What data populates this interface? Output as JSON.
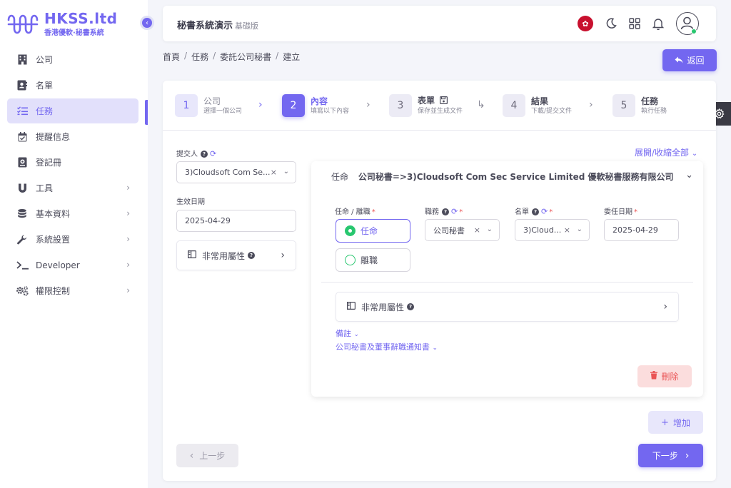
{
  "brand": {
    "title": "HKSS.ltd",
    "subtitle": "香港優軟·秘書系統",
    "accent": "#7367f0"
  },
  "sidebar": {
    "items": [
      {
        "label": "公司",
        "icon": "building-icon"
      },
      {
        "label": "名單",
        "icon": "contact-card-icon"
      },
      {
        "label": "任務",
        "icon": "task-list-icon"
      },
      {
        "label": "提醒信息",
        "icon": "calendar-icon"
      },
      {
        "label": "登記冊",
        "icon": "register-book-icon"
      },
      {
        "label": "工具",
        "icon": "magnet-icon"
      },
      {
        "label": "基本資料",
        "icon": "database-icon"
      },
      {
        "label": "系統設置",
        "icon": "wrench-icon"
      },
      {
        "label": "Developer",
        "icon": "terminal-icon"
      },
      {
        "label": "權限控制",
        "icon": "gears-icon"
      }
    ]
  },
  "header": {
    "title": "秘書系統演示",
    "subtitle": "基礎版"
  },
  "breadcrumb": [
    "首頁",
    "任務",
    "委託公司秘書",
    "建立"
  ],
  "back_label": "返回",
  "steps": [
    {
      "num": "1",
      "title": "公司",
      "desc": "選擇一個公司"
    },
    {
      "num": "2",
      "title": "內容",
      "desc": "填寫以下內容"
    },
    {
      "num": "3",
      "title": "表單",
      "desc": "保存並生成文件"
    },
    {
      "num": "4",
      "title": "結果",
      "desc": "下載/提交文件"
    },
    {
      "num": "5",
      "title": "任務",
      "desc": "執行任務"
    }
  ],
  "left_form": {
    "submitter_label": "提交人",
    "submitter_value": "3)Cloudsoft Com Se...",
    "effective_date_label": "生效日期",
    "effective_date_value": "2025-04-29",
    "uncommon_label": "非常用屬性"
  },
  "expand_all_label": "展開/收縮全部",
  "entry": {
    "head_label": "任命",
    "head_value": "公司秘書=>3)Cloudsoft Com Sec Service Limited 優軟秘書服務有限公司",
    "appoint_label": "任命 / 離職",
    "options": [
      "任命",
      "離職"
    ],
    "position_label": "職務",
    "position_value": "公司秘書",
    "roster_label": "名單",
    "roster_value": "3)Cloud...",
    "appoint_date_label": "委任日期",
    "appoint_date_value": "2025-04-29",
    "uncommon_label": "非常用屬性",
    "remarks_label": "備註",
    "notice_label": "公司秘書及董事辭職通知書",
    "delete_label": "刪除"
  },
  "add_label": "增加",
  "prev_label": "上一步",
  "next_label": "下一步"
}
